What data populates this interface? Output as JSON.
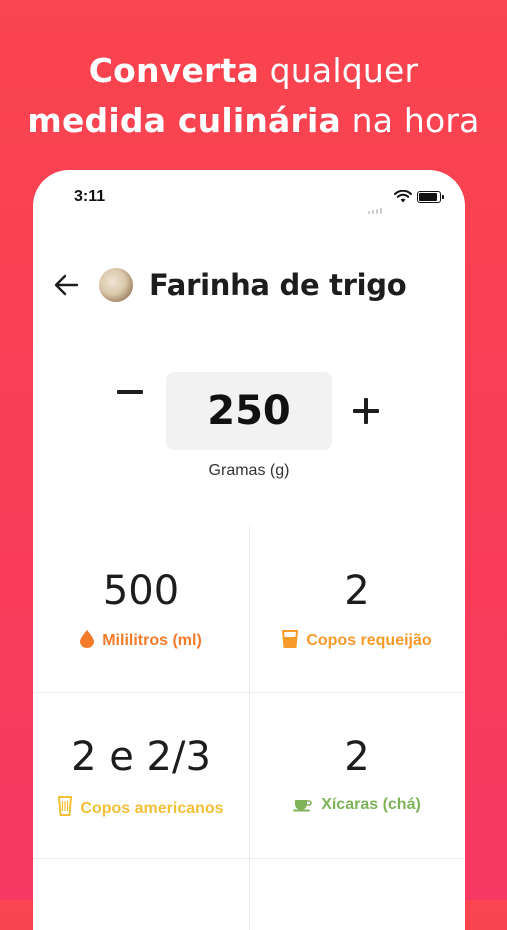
{
  "headline": {
    "line1_bold": "Converta",
    "line1_regular": " qualquer",
    "line2_bold": "medida culinária",
    "line2_regular": " na hora"
  },
  "status": {
    "time": "3:11"
  },
  "header": {
    "title": "Farinha de trigo",
    "back_icon": "arrow-left-icon",
    "avatar": "flour-photo"
  },
  "converter": {
    "value": "250",
    "unit": "Gramas (g)"
  },
  "results": [
    {
      "value": "500",
      "label": "Mililitros (ml)",
      "icon": "drop-icon",
      "color": "#f47b2a"
    },
    {
      "value": "2",
      "label": "Copos requeijão",
      "icon": "glass-icon",
      "color": "#f79a2a"
    },
    {
      "value": "2 e 2/3",
      "label": "Copos americanos",
      "icon": "tall-glass-icon",
      "color": "#f2c037"
    },
    {
      "value": "2",
      "label": "Xícaras (chá)",
      "icon": "teacup-icon",
      "color": "#7fb35a"
    }
  ]
}
